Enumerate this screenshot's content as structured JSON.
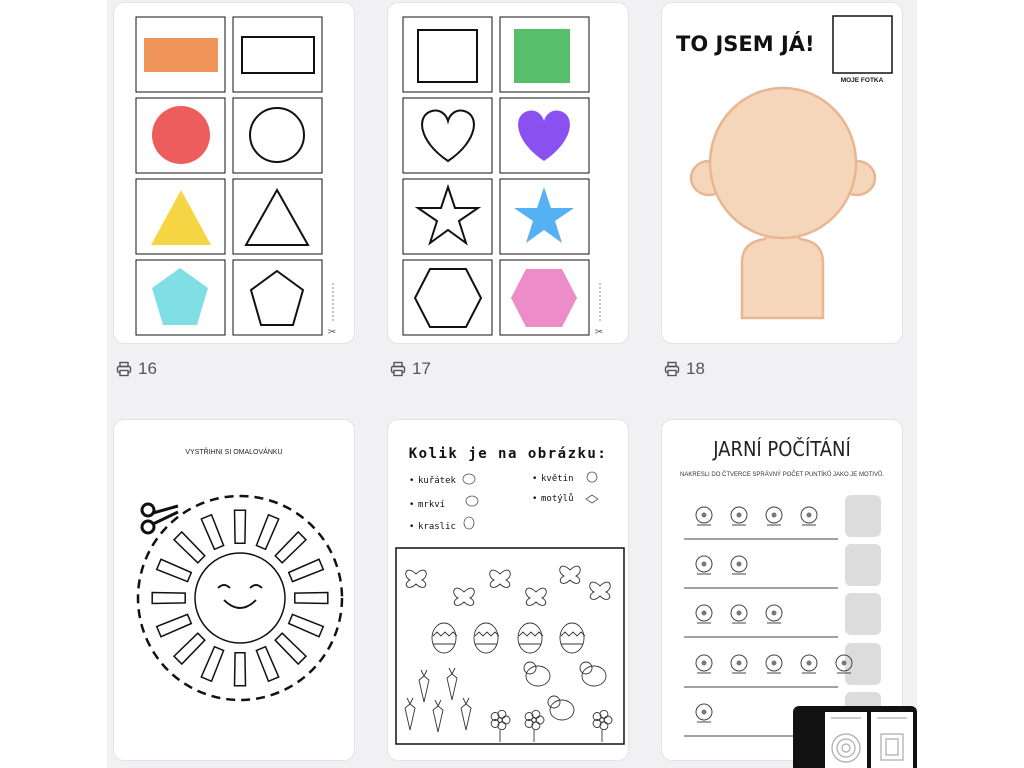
{
  "cards": [
    {
      "id": "shapes-1",
      "count": "16"
    },
    {
      "id": "shapes-2",
      "count": "17"
    },
    {
      "id": "to-jsem-ja",
      "count": "18",
      "title": "TO JSEM JÁ!",
      "photo_label": "MOJE FOTKA"
    },
    {
      "id": "sun",
      "title": "VYSTŘIHNI SI OMALOVÁNKU"
    },
    {
      "id": "kolik",
      "title": "Kolik je na obrázku:",
      "items_left": [
        "kuřátek",
        "mrkví",
        "kraslic"
      ],
      "items_right": [
        "květin",
        "motýlů"
      ]
    },
    {
      "id": "jarni",
      "title": "JARNÍ POČÍTÁNÍ",
      "subtitle": "NAKRESLI DO ČTVERCE SPRÁVNÝ POČET PUNTÍKŮ JAKO JE MOTIVŮ."
    }
  ],
  "colors": {
    "orange": "#f0955a",
    "red": "#ec5d5b",
    "yellow": "#f6d545",
    "cyan": "#7fdfe4",
    "green": "#57bf6b",
    "purple": "#8b51f0",
    "blue": "#55b0f4",
    "pink": "#ec8dca",
    "skin": "#f5d6bb",
    "skin_edge": "#e8b692"
  },
  "icons": {
    "count": "printer-icon"
  }
}
